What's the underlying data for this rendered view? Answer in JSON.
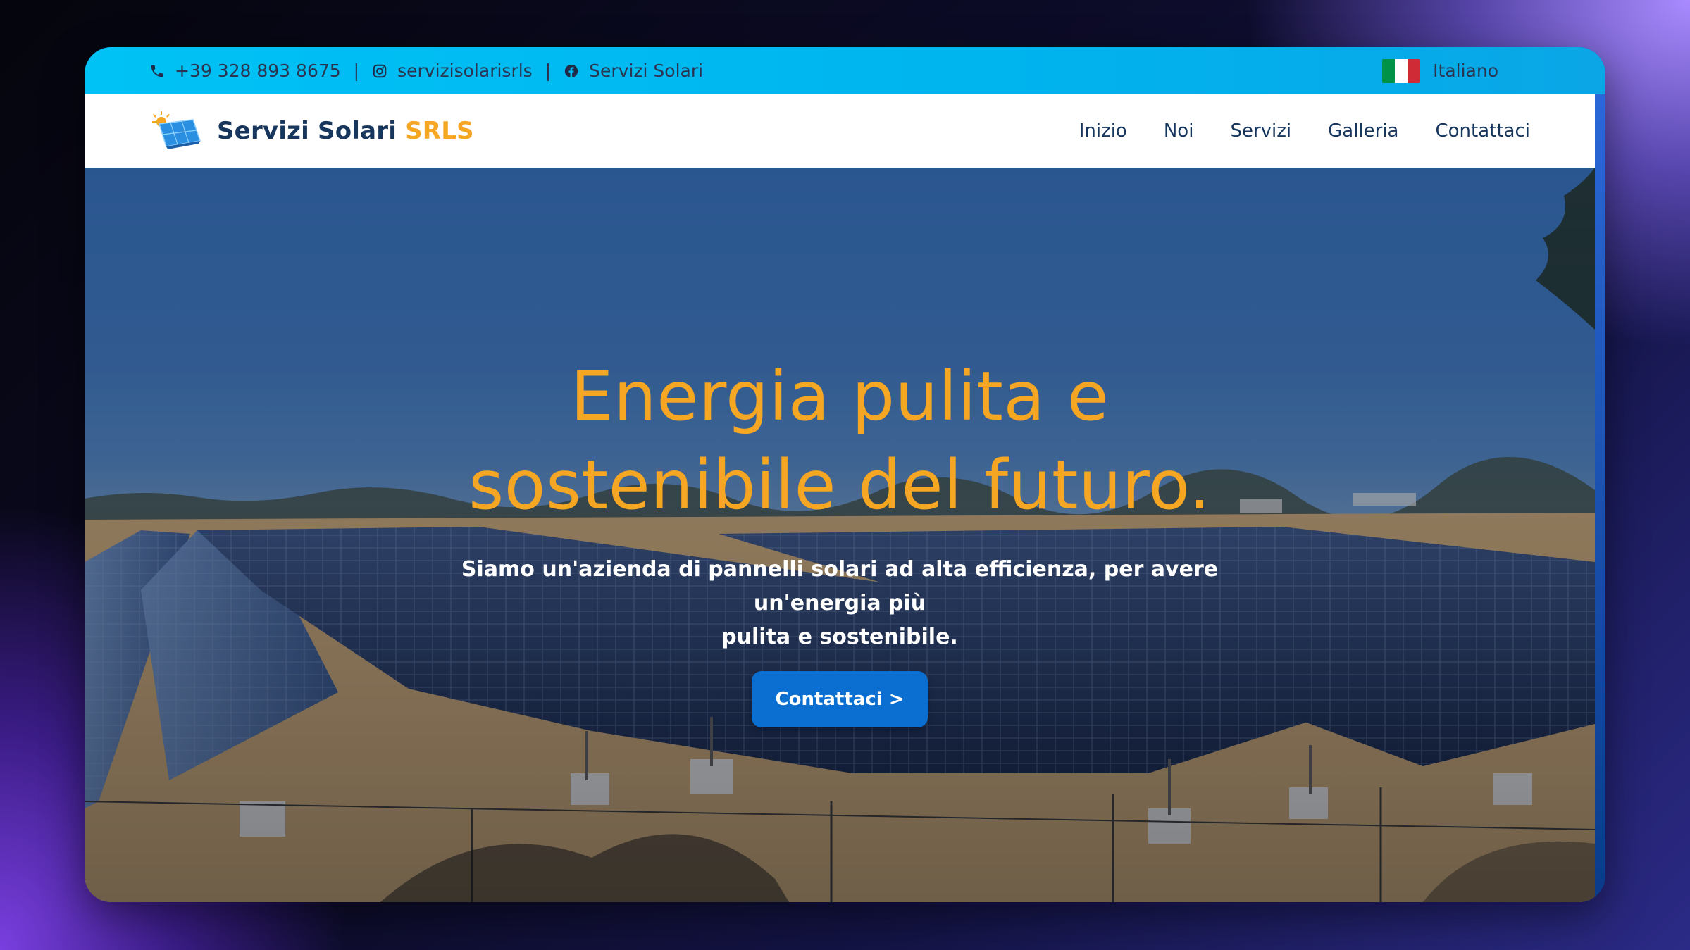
{
  "topbar": {
    "phone": "+39 328 893 8675",
    "instagram": "servizisolarisrls",
    "facebook": "Servizi Solari",
    "separator": "|",
    "language": "Italiano",
    "flag_colors": [
      "#009246",
      "#ffffff",
      "#ce2b37"
    ],
    "icons": {
      "phone": "phone-icon",
      "instagram": "instagram-icon",
      "facebook": "facebook-icon"
    }
  },
  "brand": {
    "name": "Servizi Solari",
    "accent": "SRLS",
    "accent_color": "#f5a623",
    "logo": "solar-panel-logo"
  },
  "nav": {
    "items": [
      "Inizio",
      "Noi",
      "Servizi",
      "Galleria",
      "Contattaci"
    ]
  },
  "hero": {
    "headline_line1": "Energia pulita e",
    "headline_line2": "sostenibile del futuro.",
    "subtitle_line1": "Siamo un'azienda di pannelli solari ad alta efficienza, per avere un'energia più",
    "subtitle_line2": "pulita e sostenibile.",
    "cta_label": "Contattaci >",
    "background": "solar-farm-photo"
  },
  "colors": {
    "topbar": "#00c2f5",
    "accent": "#f5a623",
    "button": "#0a6fd1",
    "nav_text": "#17365d"
  }
}
